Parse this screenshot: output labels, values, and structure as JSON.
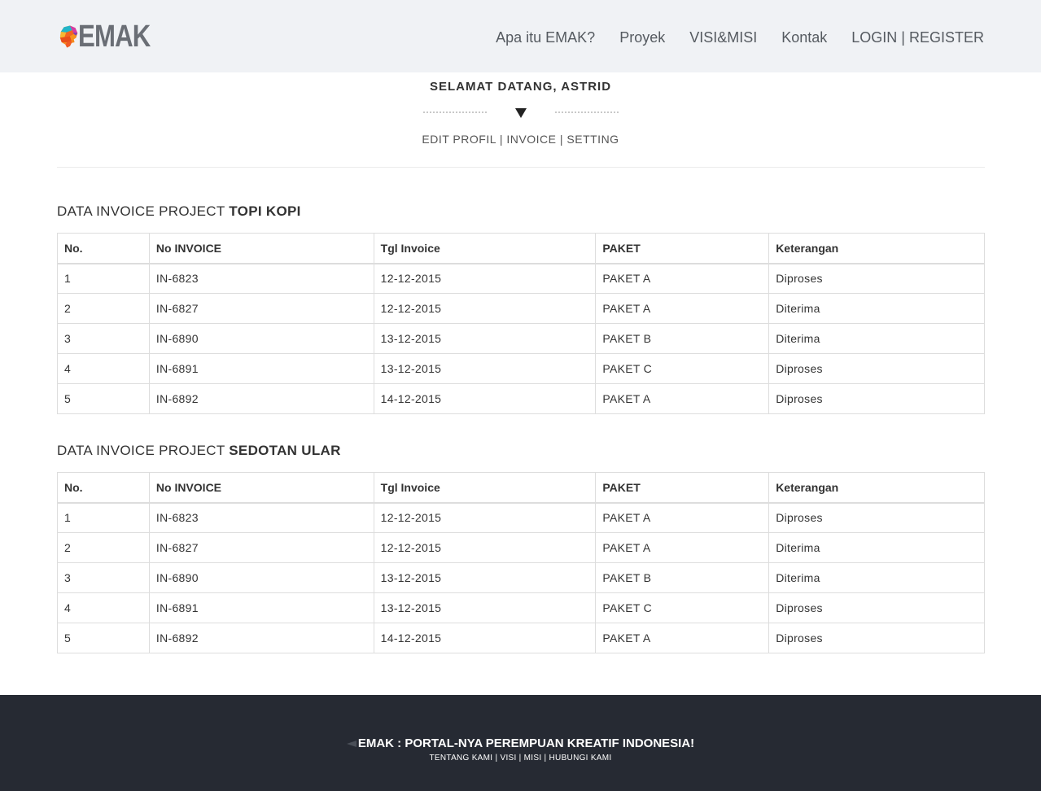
{
  "header": {
    "logo_text": "EMAK",
    "nav": [
      "Apa itu EMAK?",
      "Proyek",
      "VISI&MISI",
      "Kontak",
      "LOGIN | REGISTER"
    ]
  },
  "profile": {
    "welcome": "SELAMAT DATANG, ASTRID",
    "menu": {
      "edit_profil": "EDIT PROFIL",
      "invoice": "INVOICE",
      "setting": "SETTING",
      "separator": "|"
    }
  },
  "table_headers": [
    "No.",
    "No INVOICE",
    "Tgl Invoice",
    "PAKET",
    "Keterangan"
  ],
  "projects": [
    {
      "title_prefix": "DATA INVOICE PROJECT",
      "name": "TOPI KOPI",
      "rows": [
        [
          "1",
          "IN-6823",
          "12-12-2015",
          "PAKET A",
          "Diproses"
        ],
        [
          "2",
          "IN-6827",
          "12-12-2015",
          "PAKET A",
          "Diterima"
        ],
        [
          "3",
          "IN-6890",
          "13-12-2015",
          "PAKET B",
          "Diterima"
        ],
        [
          "4",
          "IN-6891",
          "13-12-2015",
          "PAKET C",
          "Diproses"
        ],
        [
          "5",
          "IN-6892",
          "14-12-2015",
          "PAKET A",
          "Diproses"
        ]
      ]
    },
    {
      "title_prefix": "DATA INVOICE PROJECT",
      "name": "SEDOTAN ULAR",
      "rows": [
        [
          "1",
          "IN-6823",
          "12-12-2015",
          "PAKET A",
          "Diproses"
        ],
        [
          "2",
          "IN-6827",
          "12-12-2015",
          "PAKET A",
          "Diterima"
        ],
        [
          "3",
          "IN-6890",
          "13-12-2015",
          "PAKET B",
          "Diterima"
        ],
        [
          "4",
          "IN-6891",
          "13-12-2015",
          "PAKET C",
          "Diproses"
        ],
        [
          "5",
          "IN-6892",
          "14-12-2015",
          "PAKET A",
          "Diproses"
        ]
      ]
    }
  ],
  "footer": {
    "title": "EMAK : PORTAL-NYA PEREMPUAN KREATIF INDONESIA!",
    "links": [
      "TENTANG KAMI",
      "VISI",
      "MISI",
      "HUBUNGI KAMI"
    ],
    "separator": "|"
  },
  "colors": {
    "header_bg": "#f0f2f5",
    "footer_bg": "#262a33",
    "logo_text": "#6a6e75",
    "nav_text": "#555a60",
    "table_border": "#dddddd"
  },
  "icons": {
    "logo": "woman-head-logo-icon",
    "divider": "triangle-down-icon",
    "footer": "paper-plane-icon"
  }
}
